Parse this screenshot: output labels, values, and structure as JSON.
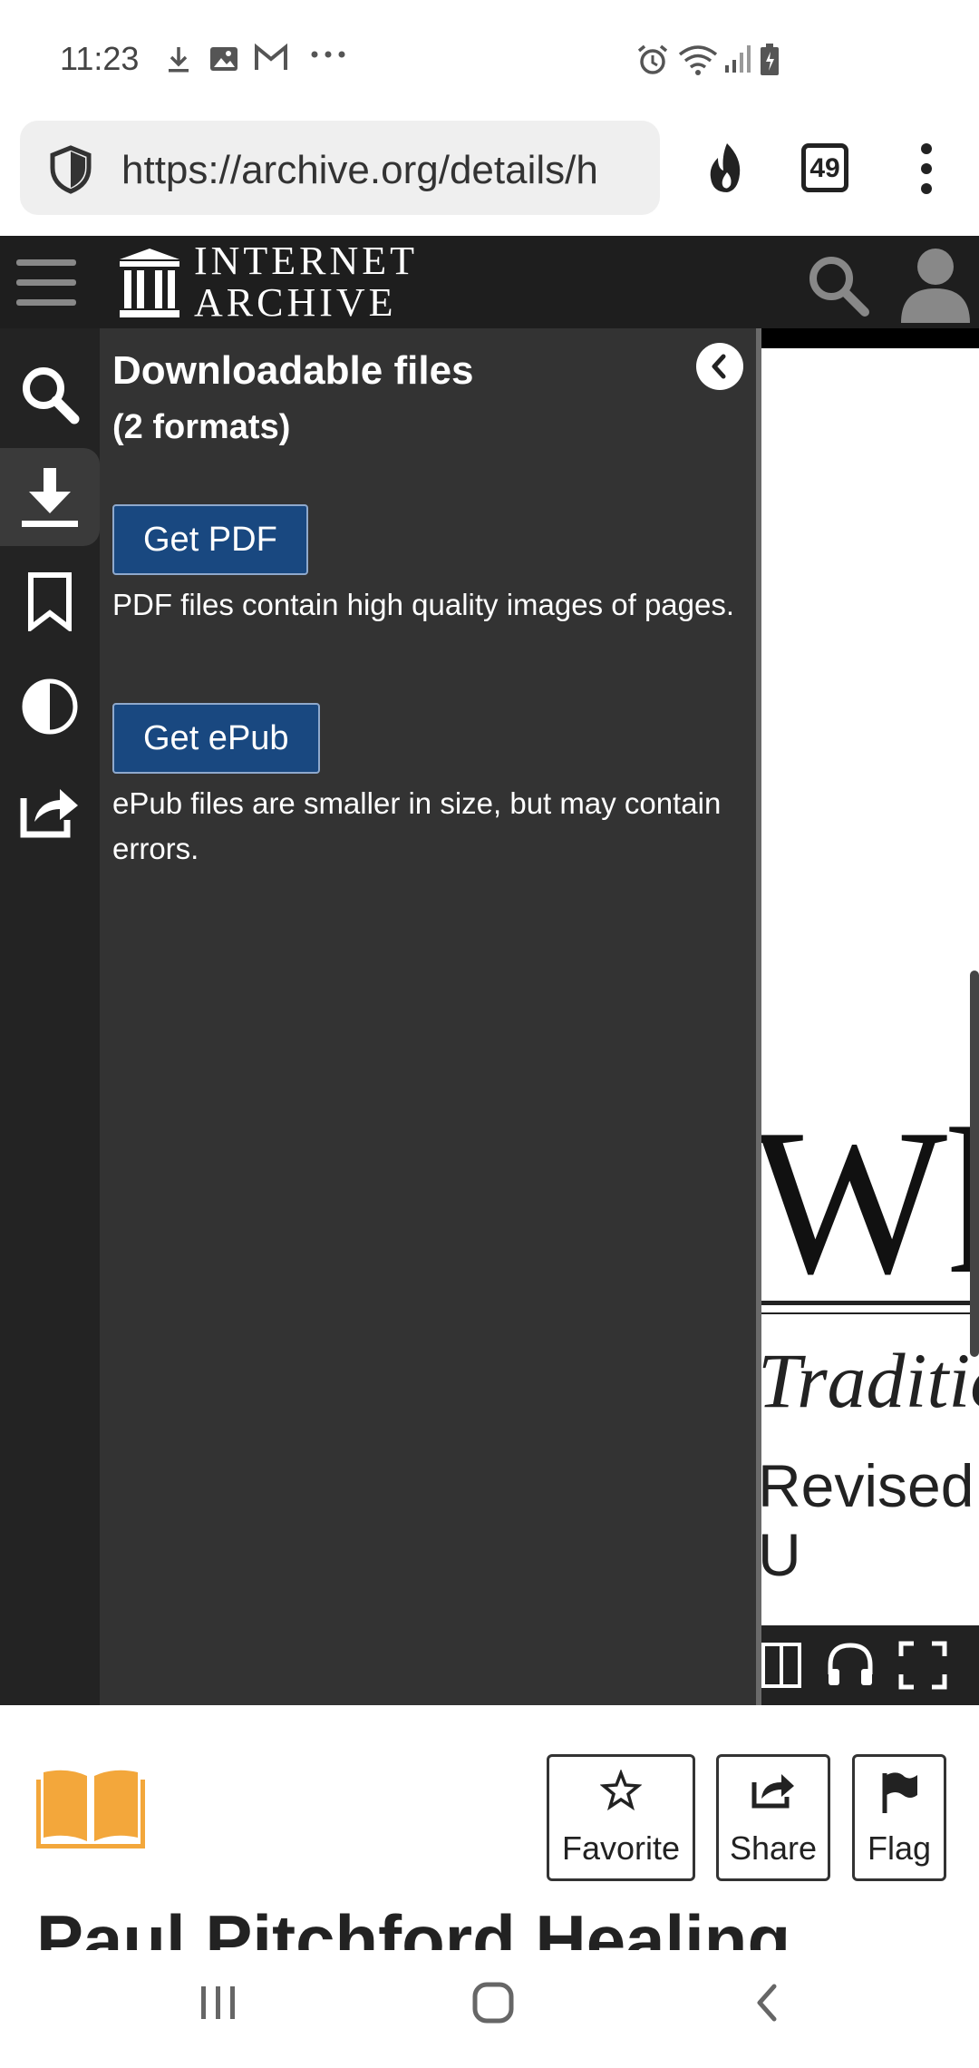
{
  "status_bar": {
    "time": "11:23",
    "icons": [
      "download-icon",
      "image-icon",
      "gmail-icon",
      "more-icon",
      "alarm-icon",
      "wifi-icon",
      "signal-icon",
      "battery-icon"
    ]
  },
  "browser": {
    "url": "https://archive.org/details/h",
    "tab_count": "49"
  },
  "header": {
    "logo_line1": "INTERNET",
    "logo_line2": "ARCHIVE"
  },
  "rail": {
    "items": [
      "search-icon",
      "download-icon",
      "bookmark-icon",
      "contrast-icon",
      "share-icon"
    ],
    "active": "download-icon"
  },
  "panel": {
    "title": "Downloadable files",
    "subtitle": "(2 formats)",
    "formats": [
      {
        "button": "Get PDF",
        "description": "PDF files contain high quality images of pages."
      },
      {
        "button": "Get ePub",
        "description": "ePub files are smaller in size, but may contain errors."
      }
    ]
  },
  "viewer": {
    "page_text_1": "Wh",
    "page_text_2": "Traditio",
    "page_text_3": "Revised, U"
  },
  "actions": {
    "favorite": "Favorite",
    "share": "Share",
    "flag": "Flag"
  },
  "item": {
    "title": "Paul Pitchford Healing"
  },
  "colors": {
    "header_bg": "#1e1e1e",
    "panel_bg": "#333333",
    "button_blue": "#194880",
    "book_icon": "#f3a73b"
  }
}
